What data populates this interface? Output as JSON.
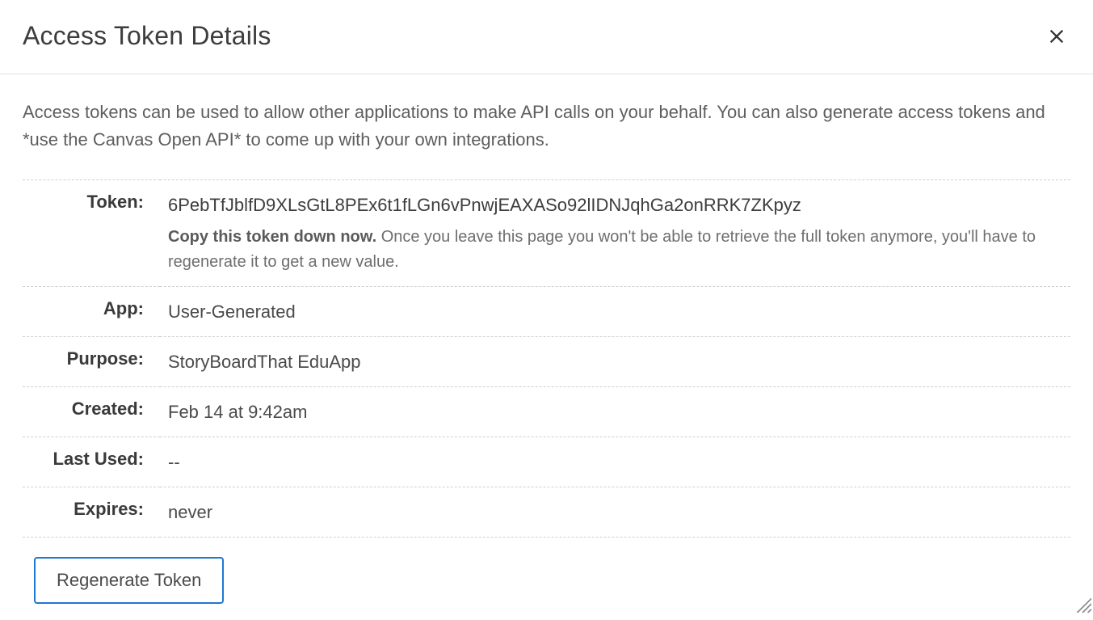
{
  "dialog": {
    "title": "Access Token Details",
    "intro": "Access tokens can be used to allow other applications to make API calls on your behalf. You can also generate access tokens and *use the Canvas Open API* to come up with your own integrations.",
    "labels": {
      "token": "Token:",
      "app": "App:",
      "purpose": "Purpose:",
      "created": "Created:",
      "last_used": "Last Used:",
      "expires": "Expires:"
    },
    "values": {
      "token": "6PebTfJblfD9XLsGtL8PEx6t1fLGn6vPnwjEAXASo92lIDNJqhGa2onRRK7ZKpyz",
      "token_warning_bold": "Copy this token down now.",
      "token_warning_rest": " Once you leave this page you won't be able to retrieve the full token anymore, you'll have to regenerate it to get a new value.",
      "app": "User-Generated",
      "purpose": "StoryBoardThat EduApp",
      "created": "Feb 14 at 9:42am",
      "last_used": "--",
      "expires": "never"
    },
    "buttons": {
      "regenerate": "Regenerate Token"
    }
  }
}
